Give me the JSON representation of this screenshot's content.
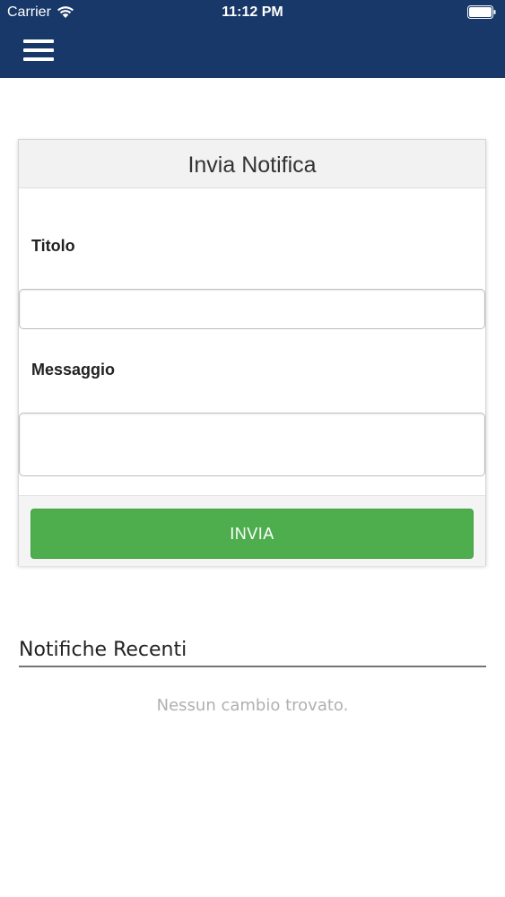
{
  "status_bar": {
    "carrier": "Carrier",
    "time": "11:12 PM"
  },
  "header": {
    "menu_icon": "hamburger-menu-icon",
    "background_color": "#173868"
  },
  "notification_form": {
    "title": "Invia Notifica",
    "title_label": "Titolo",
    "title_value": "",
    "message_label": "Messaggio",
    "message_value": "",
    "submit_label": "INVIA",
    "submit_color": "#4eae4e"
  },
  "recent": {
    "title": "Notifiche Recenti",
    "empty_text": "Nessun cambio trovato."
  }
}
